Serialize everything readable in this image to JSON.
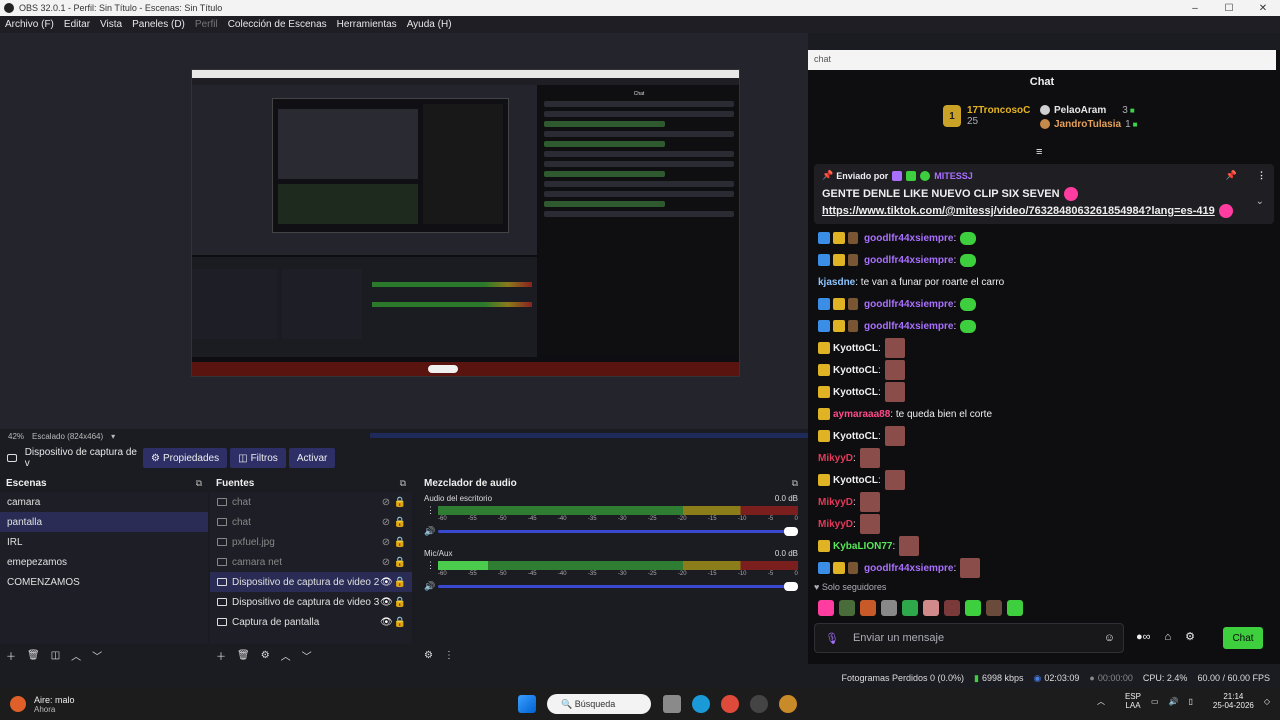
{
  "window": {
    "title": "OBS 32.0.1 - Perfil: Sin Título - Escenas: Sin Título",
    "controls": [
      "–",
      "☐",
      "✕"
    ]
  },
  "menu": [
    {
      "label": "Archivo (F)",
      "dim": false
    },
    {
      "label": "Editar",
      "dim": false
    },
    {
      "label": "Vista",
      "dim": false
    },
    {
      "label": "Paneles (D)",
      "dim": false
    },
    {
      "label": "Perfil",
      "dim": true
    },
    {
      "label": "Colección de Escenas",
      "dim": false
    },
    {
      "label": "Herramientas",
      "dim": false
    },
    {
      "label": "Ayuda (H)",
      "dim": false
    }
  ],
  "preview_status": {
    "zoom": "42%",
    "scale": "Escalado (824x464)"
  },
  "toolbar": {
    "source_name": "Dispositivo de captura de v",
    "properties": "Propiedades",
    "filters": "Filtros",
    "activate": "Activar"
  },
  "scenes": {
    "title": "Escenas",
    "items": [
      "camara",
      "pantalla",
      "IRL",
      "emepezamos",
      "COMENZAMOS"
    ],
    "selected_index": 1
  },
  "sources": {
    "title": "Fuentes",
    "items": [
      {
        "label": "chat",
        "visible": false
      },
      {
        "label": "chat",
        "visible": false
      },
      {
        "label": "pxfuel.jpg",
        "visible": false
      },
      {
        "label": "camara net",
        "visible": false
      },
      {
        "label": "Dispositivo de captura de video 2",
        "visible": true
      },
      {
        "label": "Dispositivo de captura de video 3",
        "visible": true
      },
      {
        "label": "Captura de pantalla",
        "visible": true
      }
    ],
    "selected_index": 4
  },
  "mixer": {
    "title": "Mezclador de audio",
    "channels": [
      {
        "name": "Audio del escritorio",
        "db": "0.0 dB",
        "level": 0
      },
      {
        "name": "Mic/Aux",
        "db": "0.0 dB",
        "level": 0.14
      }
    ],
    "scale": [
      "-60",
      "-55",
      "-50",
      "-45",
      "-40",
      "-35",
      "-30",
      "-25",
      "-20",
      "-15",
      "-10",
      "-5",
      "0"
    ]
  },
  "status": {
    "dropped": "Fotogramas Perdidos 0 (0.0%)",
    "bitrate": "6998 kbps",
    "stream_time": "02:03:09",
    "rec_time": "00:00:00",
    "cpu": "CPU: 2.4%",
    "fps": "60.00 / 60.00 FPS"
  },
  "chat": {
    "address": "chat",
    "title": "Chat",
    "leaderboard": {
      "first": {
        "rank": "1",
        "name": "17TroncosoC",
        "count": "25"
      },
      "second": {
        "name": "PelaoAram",
        "count": "3"
      },
      "third": {
        "name": "JandroTulasia",
        "count": "1"
      }
    },
    "pinned": {
      "sent_by": "Enviado por",
      "user": "MITESSJ",
      "message": "GENTE DENLE LIKE NUEVO CLIP SIX SEVEN",
      "link": "https://www.tiktok.com/@mitessj/video/7632848063261854984?lang=es-419"
    },
    "messages": [
      {
        "user": "goodlfr44xsiempre",
        "text": ":",
        "color": "purple",
        "badges": 3,
        "emote": "green"
      },
      {
        "user": "goodlfr44xsiempre",
        "text": ":",
        "color": "purple",
        "badges": 3,
        "emote": "green"
      },
      {
        "user": "kjasdne",
        "text": ": te van a funar por roarte el carro",
        "color": "blue",
        "badges": 0,
        "emote": ""
      },
      {
        "user": "goodlfr44xsiempre",
        "text": ":",
        "color": "purple",
        "badges": 3,
        "emote": "green"
      },
      {
        "user": "goodlfr44xsiempre",
        "text": ":",
        "color": "purple",
        "badges": 3,
        "emote": "green"
      },
      {
        "user": "KyottoCL",
        "text": ":",
        "color": "light",
        "badges": 1,
        "emote": "face"
      },
      {
        "user": "KyottoCL",
        "text": ":",
        "color": "light",
        "badges": 1,
        "emote": "face"
      },
      {
        "user": "KyottoCL",
        "text": ":",
        "color": "light",
        "badges": 1,
        "emote": "face"
      },
      {
        "user": "aymaraaa88",
        "text": ": te queda bien el corte",
        "color": "pink",
        "badges": 1,
        "emote": ""
      },
      {
        "user": "KyottoCL",
        "text": ":",
        "color": "light",
        "badges": 1,
        "emote": "face"
      },
      {
        "user": "MikyyD",
        "text": ":",
        "color": "red",
        "badges": 0,
        "emote": "face"
      },
      {
        "user": "KyottoCL",
        "text": ":",
        "color": "light",
        "badges": 1,
        "emote": "face"
      },
      {
        "user": "MikyyD",
        "text": ":",
        "color": "red",
        "badges": 0,
        "emote": "face"
      },
      {
        "user": "MikyyD",
        "text": ":",
        "color": "red",
        "badges": 0,
        "emote": "face"
      },
      {
        "user": "KybaLION77",
        "text": ":",
        "color": "green",
        "badges": 1,
        "emote": "face"
      },
      {
        "user": "goodlfr44xsiempre",
        "text": ":",
        "color": "purple",
        "badges": 3,
        "emote": "face"
      }
    ],
    "followers_only": "Solo seguidores",
    "input_placeholder": "Enviar un mensaje",
    "send_label": "Chat",
    "emote_bar": [
      "#ff3ca0",
      "#4a6b3a",
      "#c85a2a",
      "#888888",
      "#2ea84a",
      "#d08a8a",
      "#7a3a3a",
      "#3ecf3e",
      "#6a4a3a",
      "#3ecf3e"
    ]
  },
  "taskbar": {
    "weather_title": "Aire: malo",
    "weather_sub": "Ahora",
    "search": "Búsqueda",
    "lang1": "ESP",
    "lang2": "LAA",
    "time": "21:14",
    "date": "25-04-2026"
  },
  "colors": {
    "accent": "#2d2f66",
    "chat_green": "#3ecf3e",
    "twitch_purple": "#a970ff"
  }
}
